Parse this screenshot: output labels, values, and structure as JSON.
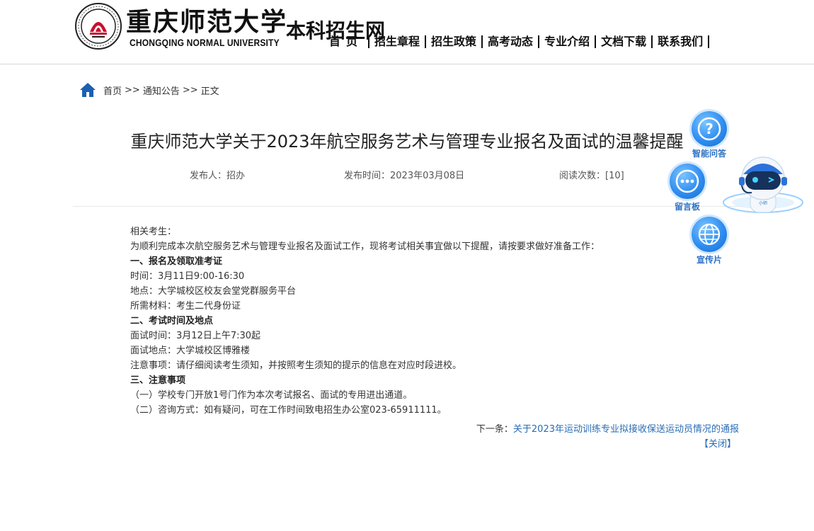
{
  "header": {
    "logo_cn": "重庆师范大学",
    "logo_en": "CHONGQING NORMAL UNIVERSITY",
    "site_title": "本科招生网"
  },
  "nav": {
    "items": [
      "首页",
      "招生章程",
      "招生政策",
      "高考动态",
      "专业介绍",
      "文档下载",
      "联系我们"
    ]
  },
  "breadcrumb": {
    "items": [
      "首页",
      "通知公告",
      "正文"
    ],
    "separator": ">>"
  },
  "article": {
    "title": "重庆师范大学关于2023年航空服务艺术与管理专业报名及面试的温馨提醒",
    "author": "发布人：招办",
    "time": "发布时间：2023年03月08日",
    "views": "阅读次数：[10]",
    "paragraphs": [
      {
        "text": "相关考生：",
        "bold": false
      },
      {
        "text": "为顺利完成本次航空服务艺术与管理专业报名及面试工作，现将考试相关事宜做以下提醒，请按要求做好准备工作：",
        "bold": false
      },
      {
        "text": "一、报名及领取准考证",
        "bold": true
      },
      {
        "text": "时间：3月11日9:00-16:30",
        "bold": false
      },
      {
        "text": "地点：大学城校区校友会堂党群服务平台",
        "bold": false
      },
      {
        "text": "所需材料：考生二代身份证",
        "bold": false
      },
      {
        "text": "二、考试时间及地点",
        "bold": true
      },
      {
        "text": "面试时间：3月12日上午7:30起",
        "bold": false
      },
      {
        "text": "面试地点：大学城校区博雅楼",
        "bold": false
      },
      {
        "text": "注意事项：请仔细阅读考生须知，并按照考生须知的提示的信息在对应时段进校。",
        "bold": false
      },
      {
        "text": "三、注意事项",
        "bold": true
      },
      {
        "text": "（一）学校专门开放1号门作为本次考试报名、面试的专用进出通道。",
        "bold": false
      },
      {
        "text": "（二）咨询方式：如有疑问，可在工作时间致电招生办公室023-65911111。",
        "bold": false
      }
    ],
    "next_prefix": "下一条：",
    "next_title": "关于2023年运动训练专业拟接收保送运动员情况的通报",
    "close_label": "【关闭】"
  },
  "widgets": {
    "qa_label": "智能问答",
    "board_label": "留言板",
    "promo_label": "宣传片",
    "robot_badge": "小师"
  },
  "colors": {
    "link": "#2a6db5",
    "widget_blue": "#2f8ef0",
    "nav_text": "#111111"
  },
  "icons": [
    "home-icon",
    "question-icon",
    "chat-dots-icon",
    "globe-icon",
    "robot-icon",
    "university-seal-icon"
  ]
}
